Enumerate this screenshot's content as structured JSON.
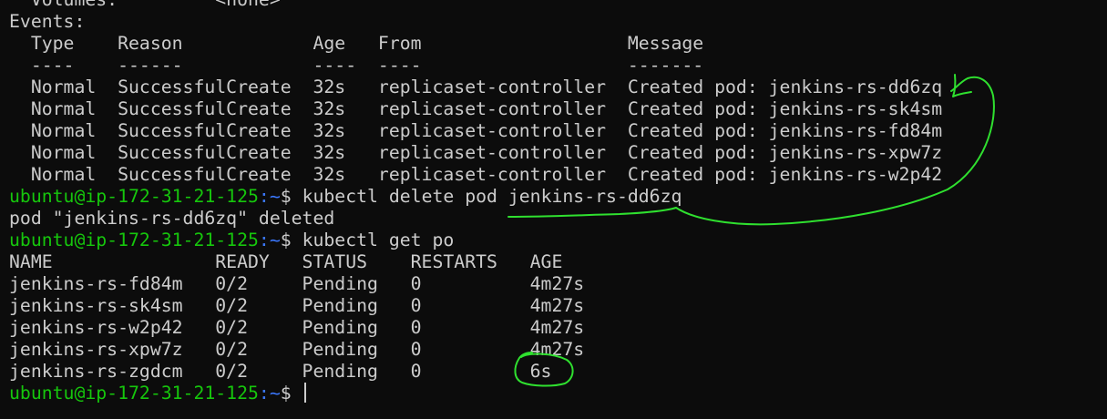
{
  "prompt": {
    "user_host": "ubuntu@ip-172-31-21-125",
    "path": ":~",
    "symbol": "$ "
  },
  "lines": [
    {
      "type": "output",
      "text": "  Volumes:         <none>"
    },
    {
      "type": "output",
      "text": "Events:"
    },
    {
      "type": "output",
      "text": "  Type    Reason            Age   From                   Message"
    },
    {
      "type": "output",
      "text": "  ----    ------            ----  ----                   -------"
    },
    {
      "type": "output",
      "text": "  Normal  SuccessfulCreate  32s   replicaset-controller  Created pod: jenkins-rs-dd6zq"
    },
    {
      "type": "output",
      "text": "  Normal  SuccessfulCreate  32s   replicaset-controller  Created pod: jenkins-rs-sk4sm"
    },
    {
      "type": "output",
      "text": "  Normal  SuccessfulCreate  32s   replicaset-controller  Created pod: jenkins-rs-fd84m"
    },
    {
      "type": "output",
      "text": "  Normal  SuccessfulCreate  32s   replicaset-controller  Created pod: jenkins-rs-xpw7z"
    },
    {
      "type": "output",
      "text": "  Normal  SuccessfulCreate  32s   replicaset-controller  Created pod: jenkins-rs-w2p42"
    },
    {
      "type": "command",
      "text": "kubectl delete pod jenkins-rs-dd6zq"
    },
    {
      "type": "output",
      "text": "pod \"jenkins-rs-dd6zq\" deleted"
    },
    {
      "type": "command",
      "text": "kubectl get po"
    },
    {
      "type": "output",
      "text": "NAME               READY   STATUS    RESTARTS   AGE"
    },
    {
      "type": "output",
      "text": "jenkins-rs-fd84m   0/2     Pending   0          4m27s"
    },
    {
      "type": "output",
      "text": "jenkins-rs-sk4sm   0/2     Pending   0          4m27s"
    },
    {
      "type": "output",
      "text": "jenkins-rs-w2p42   0/2     Pending   0          4m27s"
    },
    {
      "type": "output",
      "text": "jenkins-rs-xpw7z   0/2     Pending   0          4m27s"
    },
    {
      "type": "output",
      "text": "jenkins-rs-zgdcm   0/2     Pending   0          6s"
    },
    {
      "type": "command",
      "text": ""
    }
  ],
  "colors": {
    "background": "#0c0c0c",
    "foreground": "#cccccc",
    "prompt_host": "#16c60c",
    "prompt_path": "#3b78ff",
    "annotation": "#2fe02f"
  }
}
